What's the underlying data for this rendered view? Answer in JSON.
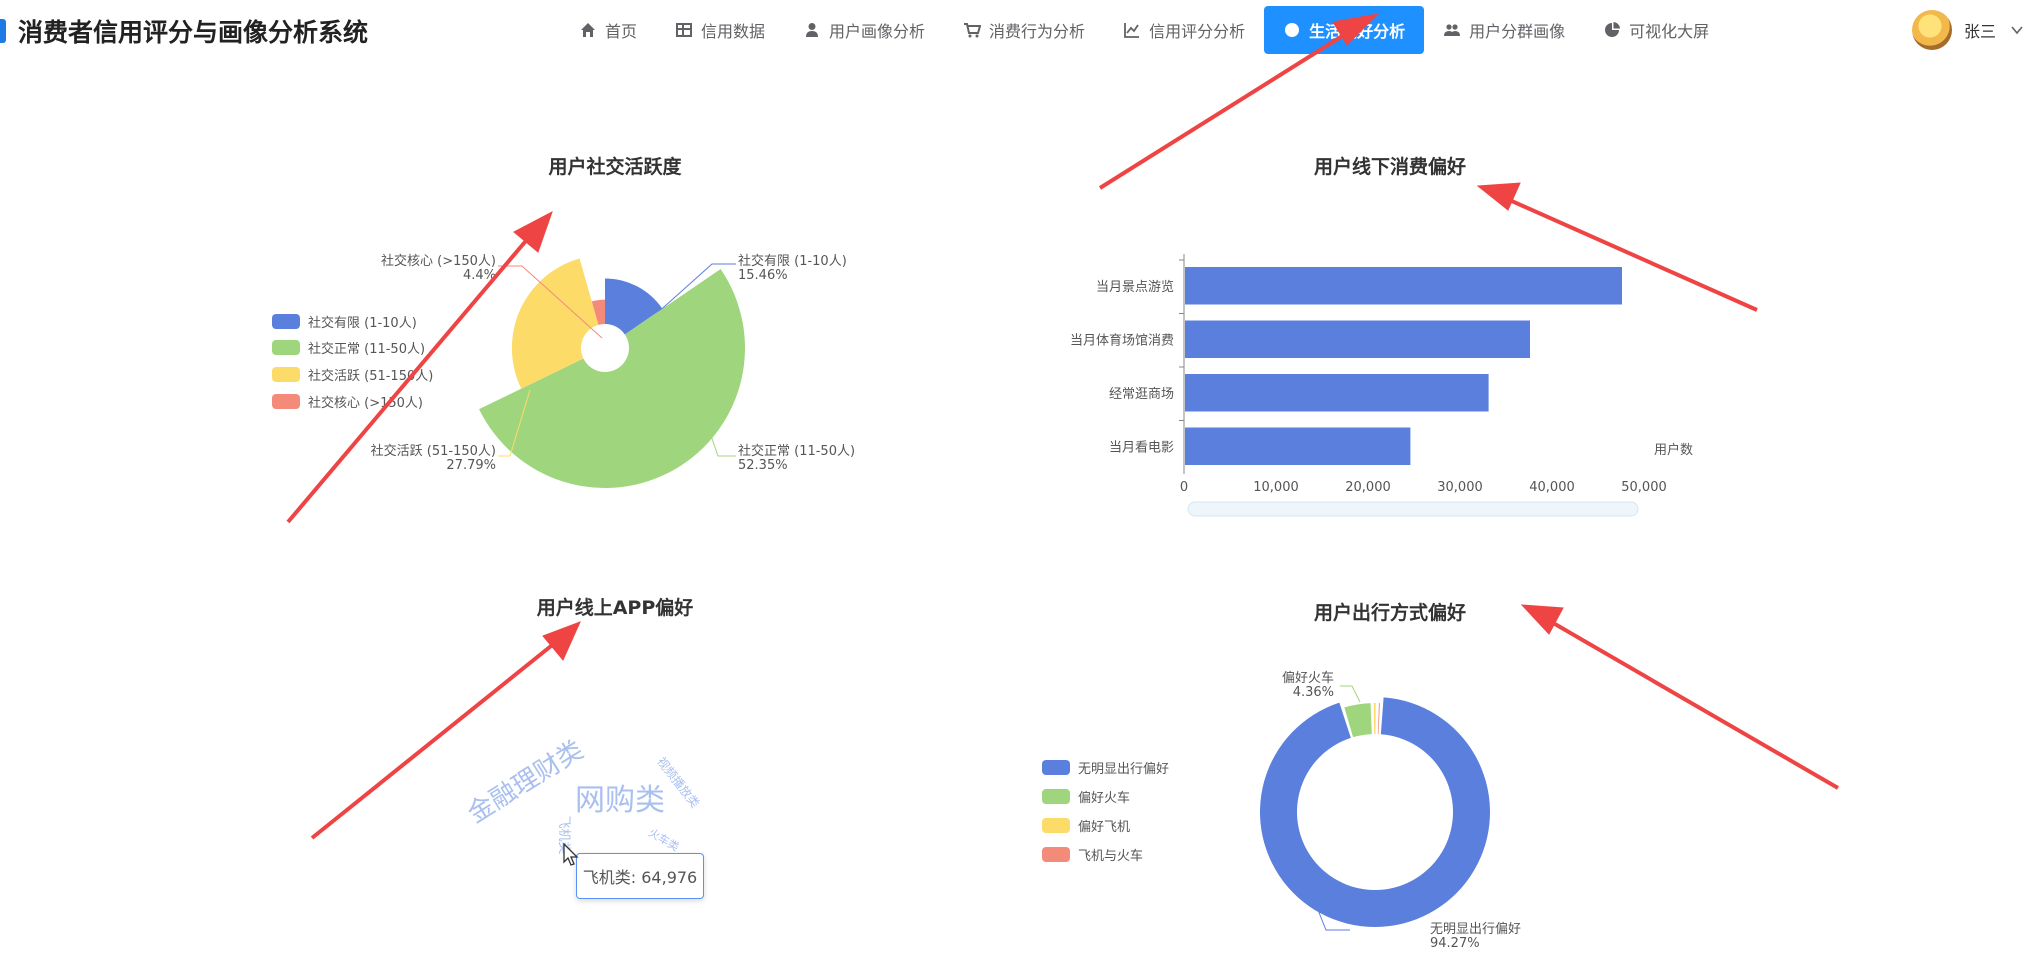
{
  "app": {
    "title": "消费者信用评分与画像分析系统",
    "brand_color": "#1e7be6"
  },
  "nav": {
    "items": [
      {
        "id": "home",
        "label": "首页",
        "icon": "home-icon"
      },
      {
        "id": "credit",
        "label": "信用数据",
        "icon": "table-icon"
      },
      {
        "id": "portrait",
        "label": "用户画像分析",
        "icon": "user-icon"
      },
      {
        "id": "consume",
        "label": "消费行为分析",
        "icon": "cart-icon"
      },
      {
        "id": "score",
        "label": "信用评分分析",
        "icon": "line-chart-icon"
      },
      {
        "id": "life",
        "label": "生活偏好分析",
        "icon": "circle-icon",
        "active": true
      },
      {
        "id": "group",
        "label": "用户分群画像",
        "icon": "group-icon"
      },
      {
        "id": "screen",
        "label": "可视化大屏",
        "icon": "pie-icon"
      }
    ],
    "active_color": "#1e90ff"
  },
  "user": {
    "name": "张三"
  },
  "tooltip": {
    "text": "飞机类: 64,976"
  },
  "chart_data": [
    {
      "type": "pie",
      "variant": "rose",
      "title": "用户社交活跃度",
      "legend_position": "left",
      "slices": [
        {
          "name": "社交有限 (1-10人)",
          "percent": "15.46%",
          "value": 15.46,
          "color": "#5b7fdd"
        },
        {
          "name": "社交正常 (11-50人)",
          "percent": "52.35%",
          "value": 52.35,
          "color": "#9fd67d"
        },
        {
          "name": "社交活跃 (51-150人)",
          "percent": "27.79%",
          "value": 27.79,
          "color": "#fddb68"
        },
        {
          "name": "社交核心 (>150人)",
          "percent": "4.4%",
          "value": 4.4,
          "color": "#f48a7a"
        }
      ]
    },
    {
      "type": "bar",
      "orientation": "horizontal",
      "title": "用户线下消费偏好",
      "categories": [
        "当月景点游览",
        "当月体育场馆消费",
        "经常逛商场",
        "当月看电影"
      ],
      "values": [
        47500,
        37500,
        33000,
        24500
      ],
      "xlabel": "用户数",
      "xlim": [
        0,
        50000
      ],
      "xticks": [
        "0",
        "10,000",
        "20,000",
        "30,000",
        "40,000",
        "50,000"
      ],
      "bar_color": "#5b7fdd"
    },
    {
      "type": "wordcloud",
      "title": "用户线上APP偏好",
      "words": [
        {
          "text": "网购类",
          "weight": 1.0
        },
        {
          "text": "金融理财类",
          "weight": 0.85
        },
        {
          "text": "飞机类",
          "weight": 0.35
        },
        {
          "text": "视频播放类",
          "weight": 0.3
        },
        {
          "text": "火车类",
          "weight": 0.25
        }
      ],
      "color": "#a9bff0"
    },
    {
      "type": "pie",
      "variant": "donut",
      "title": "用户出行方式偏好",
      "legend_position": "left",
      "slices": [
        {
          "name": "无明显出行偏好",
          "percent": "94.27%",
          "value": 94.27,
          "color": "#5b7fdd"
        },
        {
          "name": "偏好火车",
          "percent": "4.36%",
          "value": 4.36,
          "color": "#9fd67d"
        },
        {
          "name": "偏好飞机",
          "percent": "",
          "value": 0.75,
          "color": "#fddb68"
        },
        {
          "name": "飞机与火车",
          "percent": "",
          "value": 0.62,
          "color": "#f48a7a"
        }
      ]
    }
  ]
}
